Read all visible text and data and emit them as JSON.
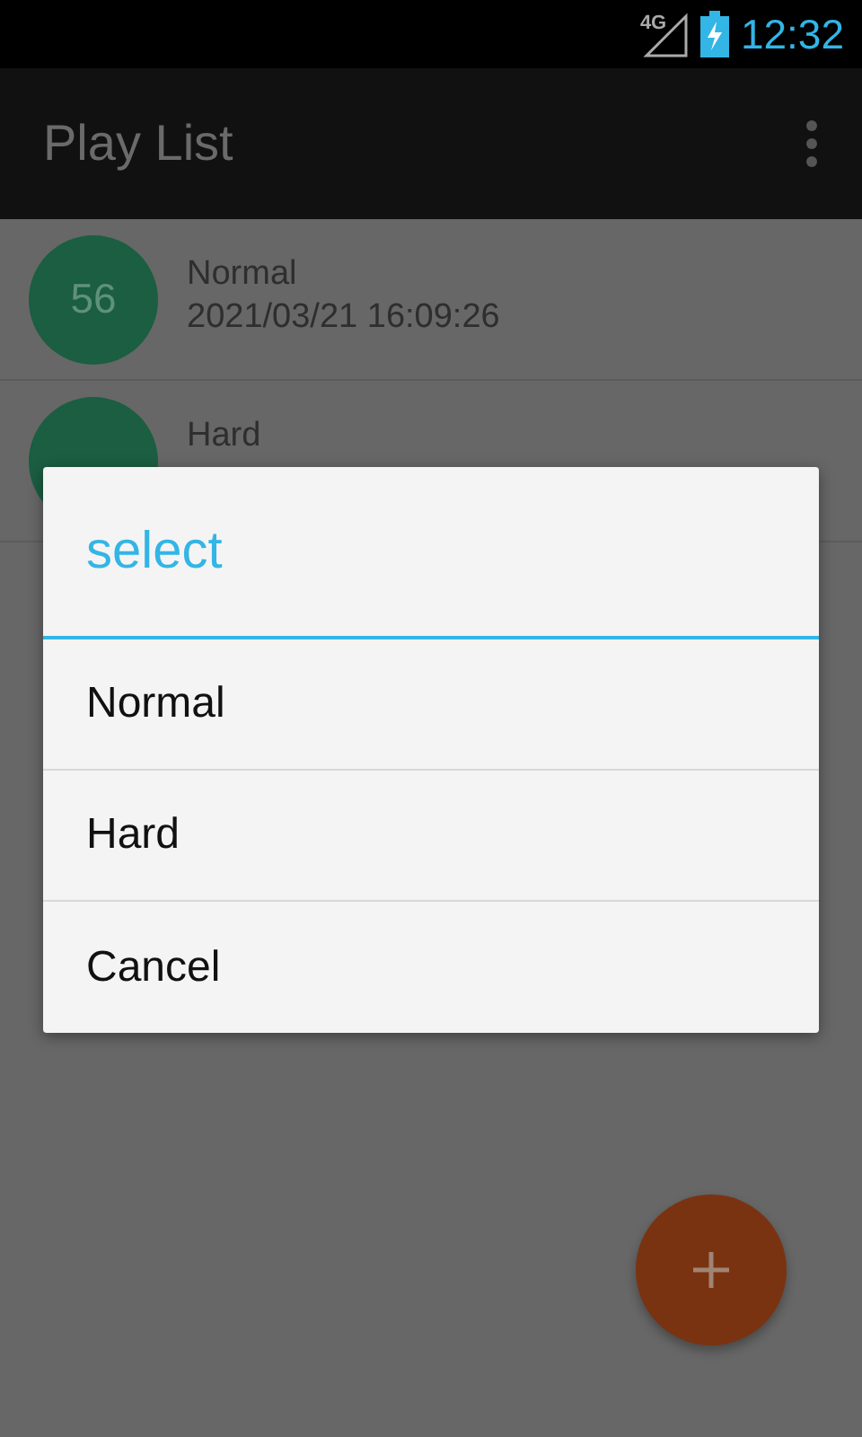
{
  "status_bar": {
    "network": "4G",
    "time": "12:32"
  },
  "app_bar": {
    "title": "Play List"
  },
  "plays": [
    {
      "score": "56",
      "mode": "Normal",
      "date": "2021/03/21 16:09:26"
    },
    {
      "mode": "Hard"
    }
  ],
  "dialog": {
    "title": "select",
    "options": [
      "Normal",
      "Hard",
      "Cancel"
    ]
  }
}
